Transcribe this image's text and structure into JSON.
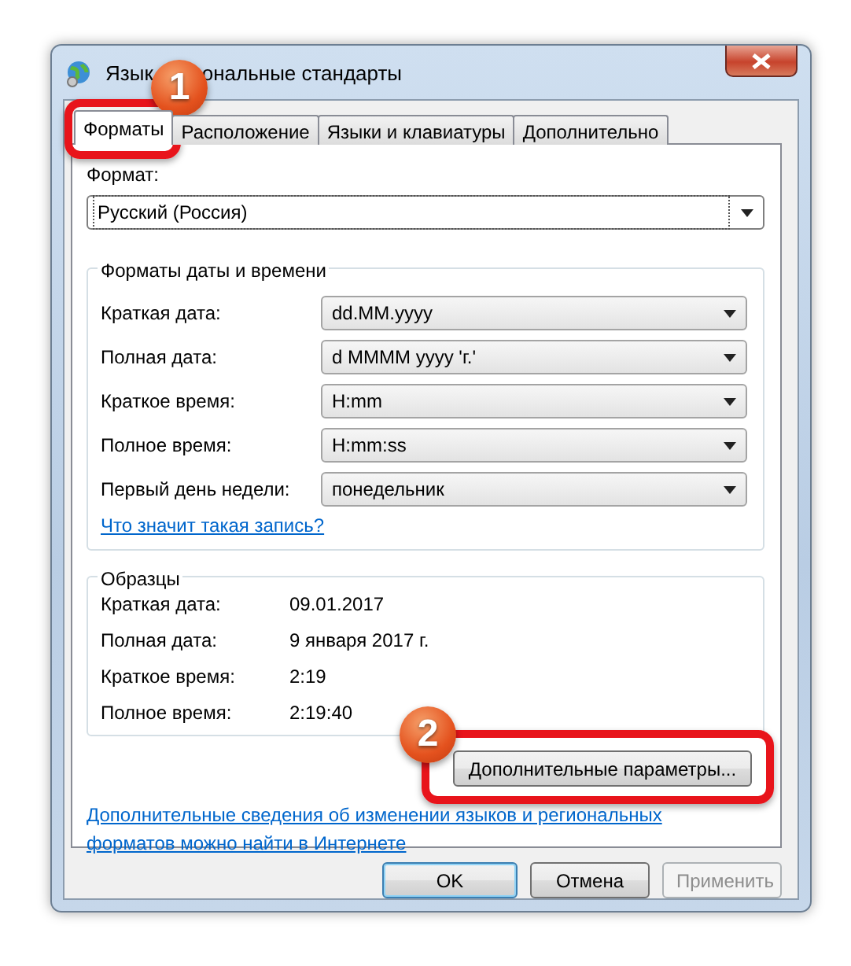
{
  "window": {
    "title_visible_parts": [
      "Язык",
      "ональные стандарты"
    ]
  },
  "tabs": [
    {
      "label": "Форматы",
      "selected": true
    },
    {
      "label": "Расположение",
      "selected": false
    },
    {
      "label": "Языки и клавиатуры",
      "selected": false
    },
    {
      "label": "Дополнительно",
      "selected": false
    }
  ],
  "format": {
    "label": "Формат:",
    "value": "Русский (Россия)"
  },
  "date_time_formats": {
    "title": "Форматы даты и времени",
    "rows": [
      {
        "label": "Краткая дата:",
        "value": "dd.MM.yyyy"
      },
      {
        "label": "Полная дата:",
        "value": "d MMMM yyyy 'г.'"
      },
      {
        "label": "Краткое время:",
        "value": "H:mm"
      },
      {
        "label": "Полное время:",
        "value": "H:mm:ss"
      },
      {
        "label": "Первый день недели:",
        "value": "понедельник"
      }
    ],
    "link": "Что значит такая запись?"
  },
  "samples": {
    "title": "Образцы",
    "rows": [
      {
        "label": "Краткая дата:",
        "value": "09.01.2017"
      },
      {
        "label": "Полная дата:",
        "value": "9 января 2017 г."
      },
      {
        "label": "Краткое время:",
        "value": "2:19"
      },
      {
        "label": "Полное время:",
        "value": "2:19:40"
      }
    ]
  },
  "advanced_button": "Дополнительные параметры...",
  "info_link": "Дополнительные сведения об изменении языков и региональных форматов можно найти в Интернете",
  "buttons": [
    {
      "label": "OK",
      "kind": "default",
      "disabled": false
    },
    {
      "label": "Отмена",
      "kind": "normal",
      "disabled": false
    },
    {
      "label": "Применить",
      "kind": "normal",
      "disabled": true
    }
  ],
  "callouts": [
    {
      "number": "1"
    },
    {
      "number": "2"
    }
  ]
}
